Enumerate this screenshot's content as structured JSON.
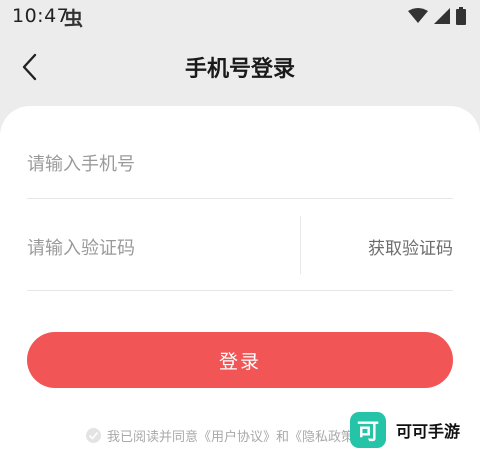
{
  "status_bar": {
    "time": "10:47",
    "app_icon_glyph": "虫"
  },
  "header": {
    "title": "手机号登录"
  },
  "form": {
    "phone_placeholder": "请输入手机号",
    "code_placeholder": "请输入验证码",
    "get_code_label": "获取验证码",
    "login_label": "登录"
  },
  "agreement": {
    "prefix": "我已阅读并同意",
    "user_agreement": "《用户协议》",
    "conjunction": "和",
    "privacy_policy": "《隐私政策》"
  },
  "watermark": {
    "logo_glyph": "可",
    "text": "可可手游"
  },
  "colors": {
    "accent": "#f25555",
    "background": "#ececec",
    "card": "#ffffff",
    "watermark_logo": "#25c3a8"
  }
}
